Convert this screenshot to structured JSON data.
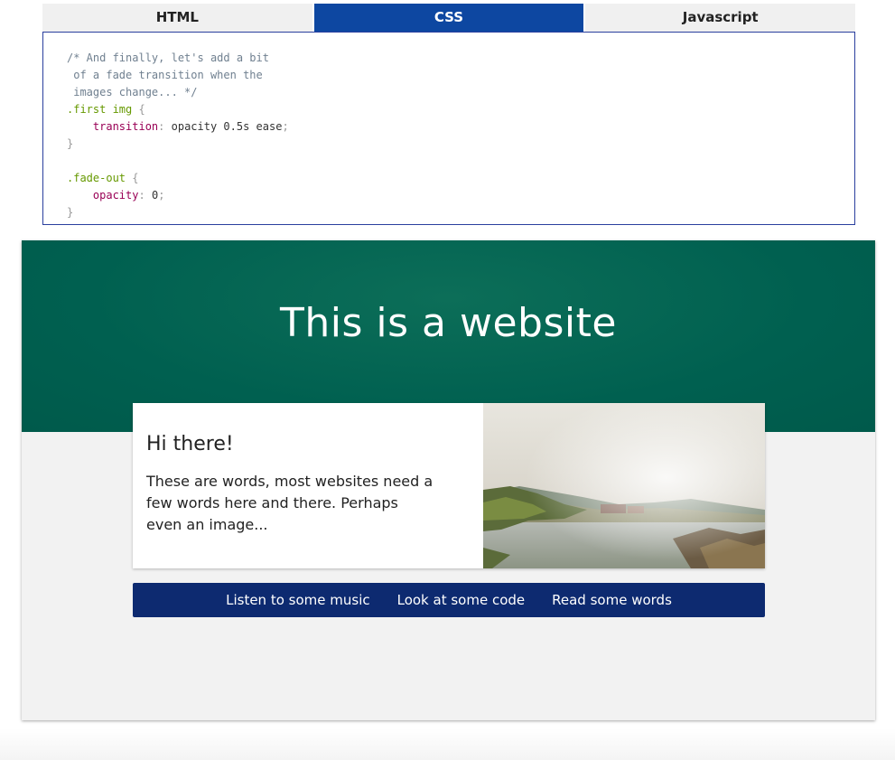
{
  "tabs": [
    {
      "label": "HTML",
      "active": false
    },
    {
      "label": "CSS",
      "active": true
    },
    {
      "label": "Javascript",
      "active": false
    }
  ],
  "code": {
    "comment": "/* And finally, let's add a bit\n of a fade transition when the\n images change... */",
    "rule1_selector": ".first img",
    "rule1_prop": "transition",
    "rule1_value": "opacity 0.5s ease",
    "rule2_selector": ".fade-out",
    "rule2_prop": "opacity",
    "rule2_value": "0"
  },
  "site": {
    "hero_title": "This is a website",
    "card_title": "Hi there!",
    "card_body": "These are words, most websites need a few words here and there. Perhaps even an image...",
    "nav": [
      "Listen to some music",
      "Look at some code",
      "Read some words"
    ]
  },
  "colors": {
    "tab_active": "#0d47a1",
    "hero": "#006050",
    "nav": "#0d2a70"
  }
}
